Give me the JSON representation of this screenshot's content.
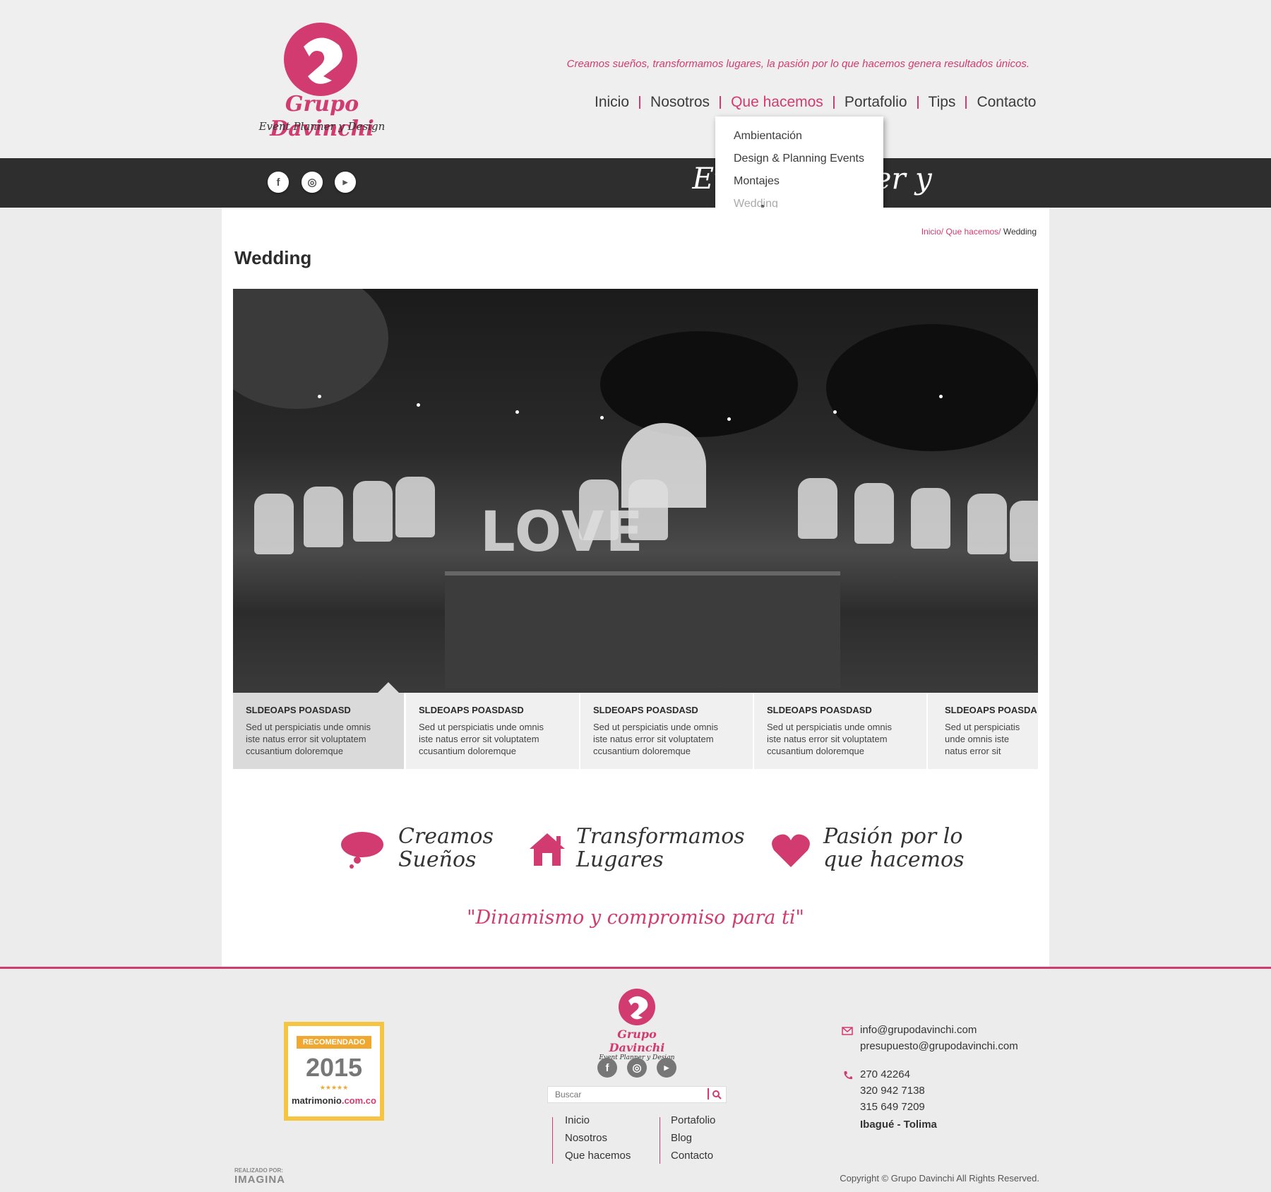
{
  "brand": {
    "name": "Grupo Davinchi",
    "subtitle": "Event Planner y Design",
    "accent_color": "#d23b6f",
    "dark_color": "#2e2e2e"
  },
  "header": {
    "tagline": "Creamos sueños, transformamos lugares, la pasión por lo que hacemos genera resultados únicos.",
    "nav": [
      {
        "label": "Inicio",
        "active": false
      },
      {
        "label": "Nosotros",
        "active": false
      },
      {
        "label": "Que hacemos",
        "active": true
      },
      {
        "label": "Portafolio",
        "active": false
      },
      {
        "label": "Tips",
        "active": false
      },
      {
        "label": "Contacto",
        "active": false
      }
    ],
    "dropdown": [
      "Ambientación",
      "Design & Planning Events",
      "Montajes",
      "Wedding"
    ]
  },
  "strip": {
    "title": "Event Planner y Design",
    "social_icons": [
      "facebook-icon",
      "instagram-icon",
      "youtube-icon"
    ]
  },
  "breadcrumb": {
    "home": "Inicio/",
    "section": "Que hacemos/",
    "current": "Wedding"
  },
  "page": {
    "title": "Wedding",
    "hero_text": "LOVE"
  },
  "slider_tabs": [
    {
      "title": "SLDEOAPS POASDASD",
      "text": "Sed ut perspiciatis unde omnis iste natus error sit voluptatem ccusantium doloremque",
      "active": true
    },
    {
      "title": "SLDEOAPS POASDASD",
      "text": "Sed ut perspiciatis unde omnis iste natus error sit voluptatem ccusantium doloremque",
      "active": false
    },
    {
      "title": "SLDEOAPS POASDASD",
      "text": "Sed ut perspiciatis unde omnis iste natus error sit voluptatem ccusantium doloremque",
      "active": false
    },
    {
      "title": "SLDEOAPS POASDASD",
      "text": "Sed ut perspiciatis unde omnis iste natus error sit voluptatem ccusantium doloremque",
      "active": false
    },
    {
      "title": "SLDEOAPS POASDAS",
      "text": "Sed ut perspiciatis unde omnis iste natus error sit",
      "active": false
    }
  ],
  "features": [
    {
      "icon": "cloud-icon",
      "line1": "Creamos",
      "line2": "Sueños"
    },
    {
      "icon": "house-icon",
      "line1": "Transformamos",
      "line2": "Lugares"
    },
    {
      "icon": "heart-icon",
      "line1": "Pasión por lo",
      "line2": "que hacemos"
    }
  ],
  "motto": "\"Dinamismo y compromiso para ti\"",
  "footer": {
    "badge": {
      "label": "RECOMENDADO",
      "year": "2015",
      "stars": "★★★★★",
      "site_a": "matrimonio",
      "site_b": ".com.co"
    },
    "search_placeholder": "Buscar",
    "links_col1": [
      "Inicio",
      "Nosotros",
      "Que hacemos"
    ],
    "links_col2": [
      "Portafolio",
      "Blog",
      "Contacto"
    ],
    "emails": [
      "info@grupodavinchi.com",
      "presupuesto@grupodavinchi.com"
    ],
    "phones": [
      "270 42264",
      "320 942 7138",
      "315 649 7209"
    ],
    "city": "Ibagué - Tolima",
    "credit_label": "REALIZADO POR:",
    "credit_name": "IMAGINA",
    "copyright": "Copyright © Grupo Davinchi All Rights Reserved."
  }
}
